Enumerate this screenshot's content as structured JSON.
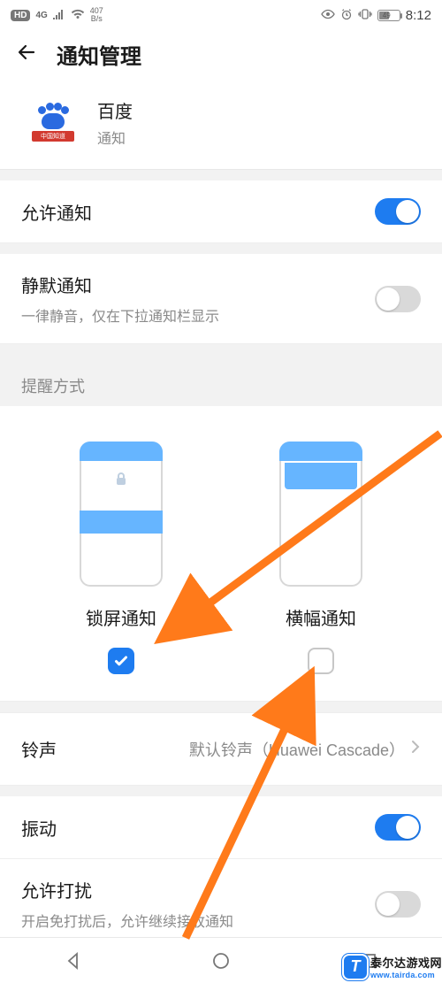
{
  "status": {
    "hd": "HD",
    "net_gen": "4G",
    "net_speed_num": "407",
    "net_speed_unit": "B/s",
    "battery_text": "49",
    "time": "8:12"
  },
  "header": {
    "title": "通知管理"
  },
  "app": {
    "name": "百度",
    "sub": "通知",
    "icon_band": "中国知道"
  },
  "settings": {
    "allow_notif": {
      "label": "允许通知",
      "on": true
    },
    "silent": {
      "label": "静默通知",
      "sub": "一律静音，仅在下拉通知栏显示",
      "on": false
    },
    "reminder_header": "提醒方式",
    "lockscreen": {
      "label": "锁屏通知",
      "checked": true
    },
    "banner": {
      "label": "横幅通知",
      "checked": false
    },
    "ringtone": {
      "label": "铃声",
      "value": "默认铃声（Huawei Cascade）"
    },
    "vibrate": {
      "label": "振动",
      "on": true
    },
    "disturb": {
      "label": "允许打扰",
      "sub": "开启免打扰后，允许继续接收通知",
      "on": false
    }
  },
  "watermark": {
    "title": "泰尔达游戏网",
    "url": "www.tairda.com",
    "glyph": "T"
  }
}
